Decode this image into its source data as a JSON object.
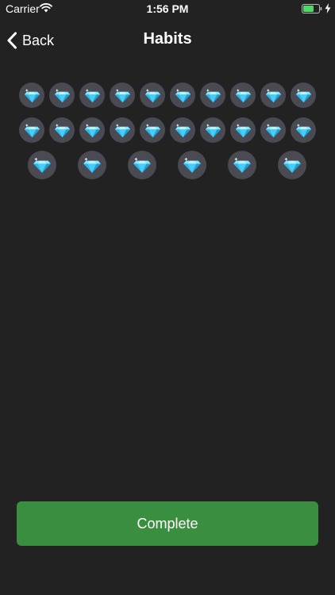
{
  "status_bar": {
    "carrier": "Carrier",
    "time": "1:56 PM",
    "icons": [
      "wifi-icon",
      "battery-icon",
      "charging-bolt-icon"
    ],
    "battery_color": "#4cd964"
  },
  "nav": {
    "back_label": "Back",
    "title": "Habits",
    "back_icon": "chevron-left-icon"
  },
  "gems": {
    "icon": "diamond-icon",
    "row_counts": [
      10,
      10,
      6
    ],
    "total": 26,
    "gem_color": "#4fd4ff",
    "badge_color": "#4a4a52"
  },
  "complete_button": {
    "label": "Complete",
    "color": "#3a8e3f"
  },
  "colors": {
    "background": "#222222"
  }
}
